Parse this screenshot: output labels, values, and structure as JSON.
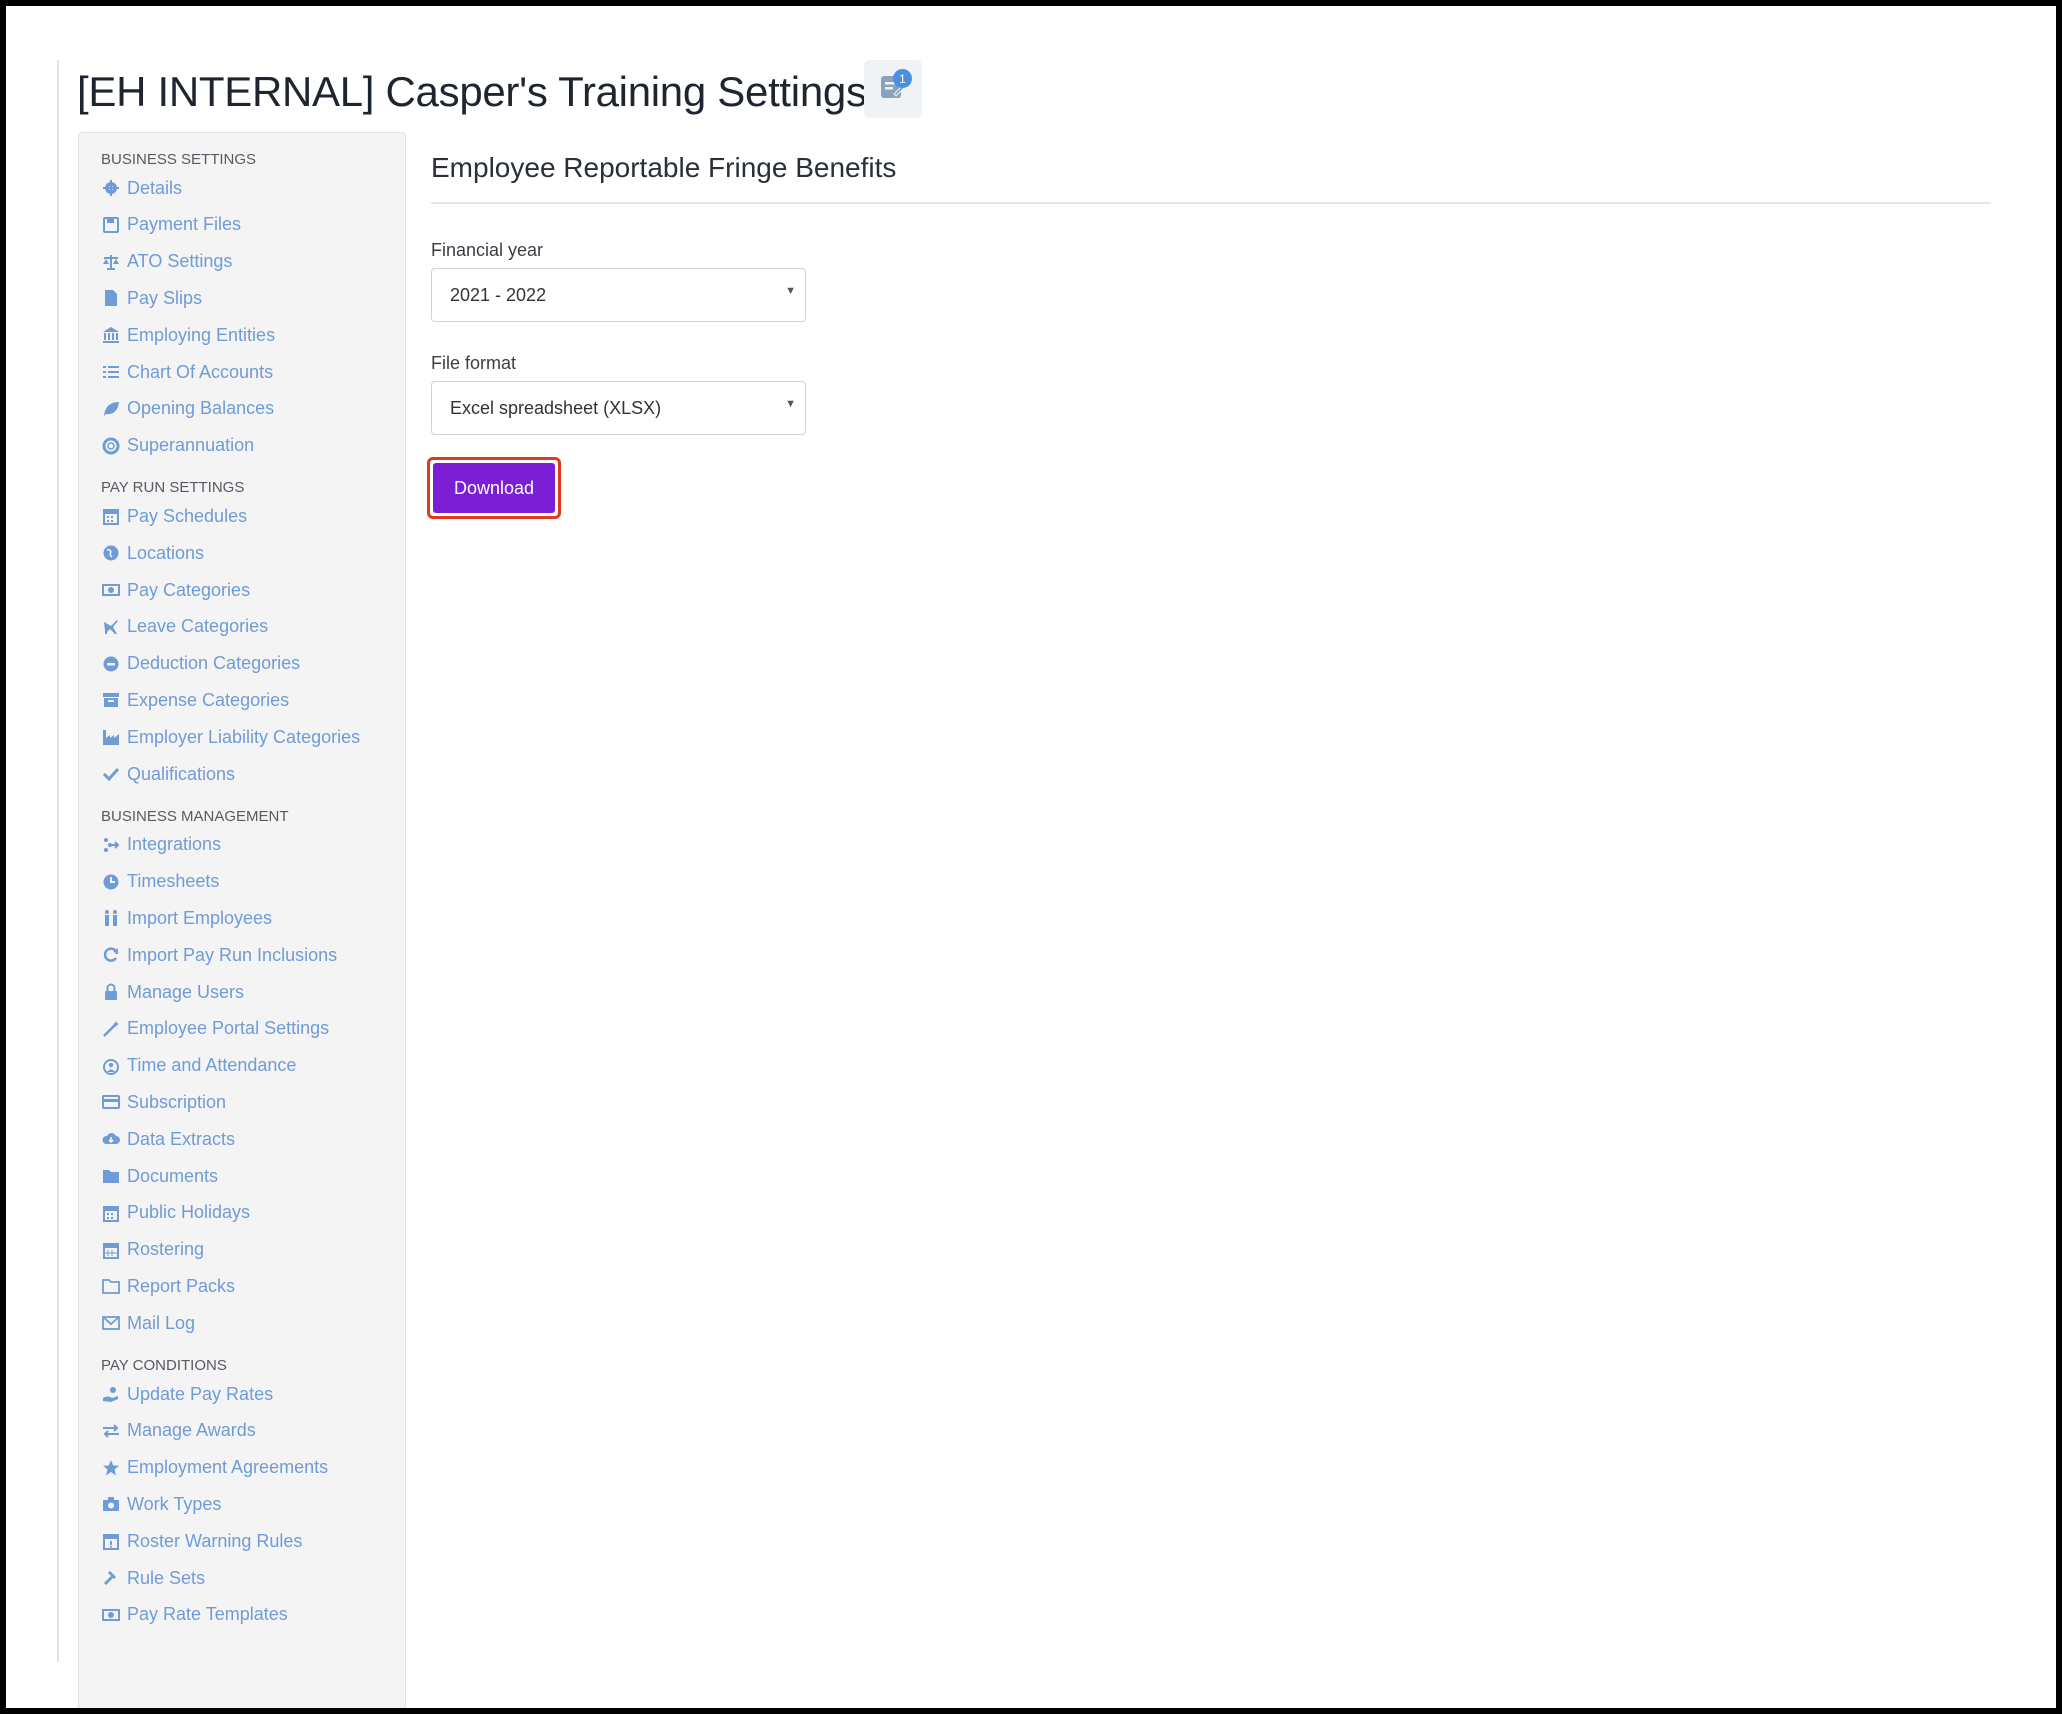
{
  "page": {
    "title": "[EH INTERNAL] Casper's Training Settings",
    "notes_badge": "1"
  },
  "sidebar": {
    "sections": [
      {
        "label": "BUSINESS SETTINGS",
        "items": [
          {
            "label": "Details",
            "icon": "gear-icon"
          },
          {
            "label": "Payment Files",
            "icon": "floppy-disk-icon"
          },
          {
            "label": "ATO Settings",
            "icon": "balance-scale-icon"
          },
          {
            "label": "Pay Slips",
            "icon": "file-icon"
          },
          {
            "label": "Employing Entities",
            "icon": "institution-icon"
          },
          {
            "label": "Chart Of Accounts",
            "icon": "list-icon"
          },
          {
            "label": "Opening Balances",
            "icon": "leaf-icon"
          },
          {
            "label": "Superannuation",
            "icon": "life-ring-icon"
          }
        ]
      },
      {
        "label": "PAY RUN SETTINGS",
        "items": [
          {
            "label": "Pay Schedules",
            "icon": "calendar-icon"
          },
          {
            "label": "Locations",
            "icon": "globe-icon"
          },
          {
            "label": "Pay Categories",
            "icon": "money-icon"
          },
          {
            "label": "Leave Categories",
            "icon": "plane-icon"
          },
          {
            "label": "Deduction Categories",
            "icon": "minus-circle-icon"
          },
          {
            "label": "Expense Categories",
            "icon": "archive-icon"
          },
          {
            "label": "Employer Liability Categories",
            "icon": "industry-icon"
          },
          {
            "label": "Qualifications",
            "icon": "check-icon"
          }
        ]
      },
      {
        "label": "BUSINESS MANAGEMENT",
        "items": [
          {
            "label": "Integrations",
            "icon": "integration-icon"
          },
          {
            "label": "Timesheets",
            "icon": "clock-icon"
          },
          {
            "label": "Import Employees",
            "icon": "users-icon"
          },
          {
            "label": "Import Pay Run Inclusions",
            "icon": "refresh-icon"
          },
          {
            "label": "Manage Users",
            "icon": "lock-icon"
          },
          {
            "label": "Employee Portal Settings",
            "icon": "magic-wand-icon"
          },
          {
            "label": "Time and Attendance",
            "icon": "clock-user-icon"
          },
          {
            "label": "Subscription",
            "icon": "credit-card-icon"
          },
          {
            "label": "Data Extracts",
            "icon": "cloud-download-icon"
          },
          {
            "label": "Documents",
            "icon": "folder-icon"
          },
          {
            "label": "Public Holidays",
            "icon": "calendar-icon"
          },
          {
            "label": "Rostering",
            "icon": "calendar-grid-icon"
          },
          {
            "label": "Report Packs",
            "icon": "folder-open-icon"
          },
          {
            "label": "Mail Log",
            "icon": "envelope-icon"
          }
        ]
      },
      {
        "label": "PAY CONDITIONS",
        "items": [
          {
            "label": "Update Pay Rates",
            "icon": "hand-money-icon"
          },
          {
            "label": "Manage Awards",
            "icon": "exchange-icon"
          },
          {
            "label": "Employment Agreements",
            "icon": "star-icon"
          },
          {
            "label": "Work Types",
            "icon": "camera-icon"
          },
          {
            "label": "Roster Warning Rules",
            "icon": "calendar-warning-icon"
          },
          {
            "label": "Rule Sets",
            "icon": "gavel-icon"
          },
          {
            "label": "Pay Rate Templates",
            "icon": "money-icon"
          }
        ]
      }
    ]
  },
  "main": {
    "heading": "Employee Reportable Fringe Benefits",
    "financial_year": {
      "label": "Financial year",
      "value": "2021 - 2022"
    },
    "file_format": {
      "label": "File format",
      "value": "Excel spreadsheet (XLSX)"
    },
    "download_label": "Download"
  },
  "colors": {
    "link": "#6f9bd6",
    "download_button": "#7a1fd6",
    "highlight_outline": "#e0391f"
  }
}
